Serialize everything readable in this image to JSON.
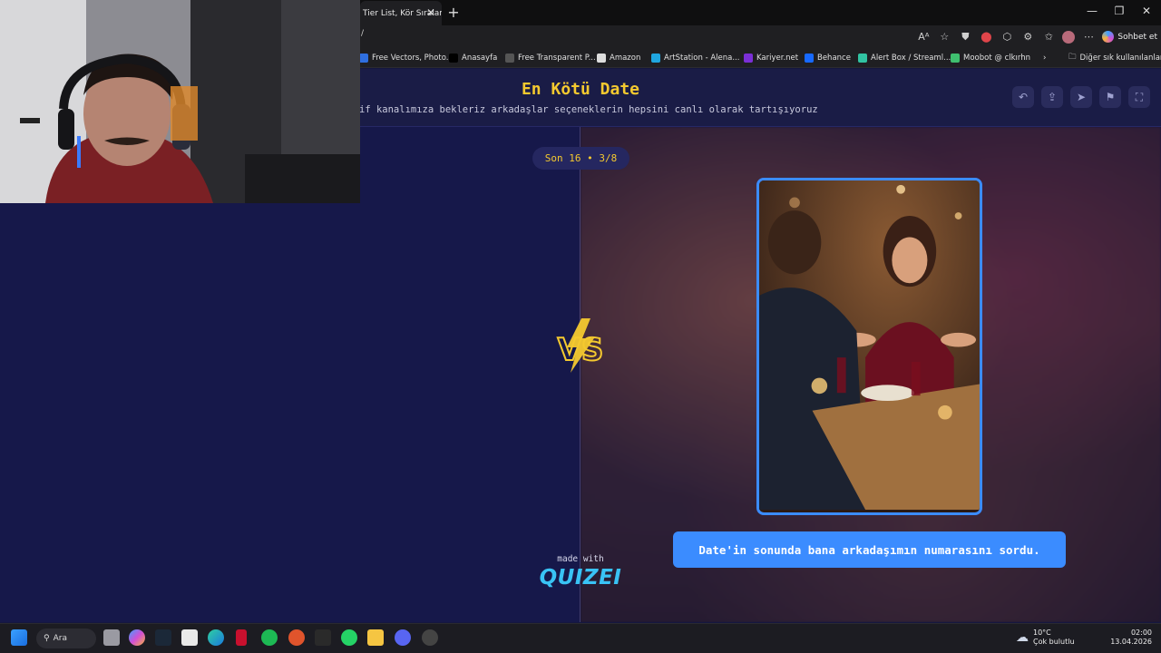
{
  "browser": {
    "tab_title": "Tier List, Kör Sıralam",
    "url_fragment": "/",
    "copilot_label": "Sohbet et",
    "bookmarks": [
      {
        "label": "Free Vectors, Photo...",
        "icon": "freepik-icon",
        "color": "#2f6fdf"
      },
      {
        "label": "Anasayfa",
        "icon": "x-icon",
        "color": "#000000"
      },
      {
        "label": "Free Transparent P...",
        "icon": "pngtree-icon",
        "color": "#555555"
      },
      {
        "label": "Amazon",
        "icon": "amazon-icon",
        "color": "#dddddd"
      },
      {
        "label": "ArtStation - Alena...",
        "icon": "artstation-icon",
        "color": "#1fa6e0"
      },
      {
        "label": "Kariyer.net",
        "icon": "kariyer-icon",
        "color": "#7b2fd6"
      },
      {
        "label": "Behance",
        "icon": "behance-icon",
        "color": "#1769ff"
      },
      {
        "label": "Alert Box / Streaml...",
        "icon": "streamlabs-icon",
        "color": "#31c3a2"
      },
      {
        "label": "Moobot @ clkırhn",
        "icon": "moobot-icon",
        "color": "#3fbf6f"
      }
    ],
    "other_bookmarks_label": "Diğer sık kullanılanlar"
  },
  "game": {
    "title": "En Kötü Date",
    "subtitle": "if kanalımıza bekleriz arkadaşlar seçeneklerin hepsini canlı olarak tartışıyoruz",
    "counter": "Son 16 • 3/8",
    "vs_label": "VS",
    "caption": "Date'in sonunda bana arkadaşımın numarasını sordu.",
    "made_with": "made with",
    "brand": "QUIZEI",
    "header_buttons": [
      "undo-icon",
      "share-icon",
      "send-icon",
      "flag-icon",
      "fullscreen-icon"
    ]
  },
  "taskbar": {
    "search_label": "Ara",
    "weather_temp": "10°C",
    "weather_desc": "Çok bulutlu",
    "time": "02:00",
    "date": "13.04.2026"
  },
  "colors": {
    "accent_yellow": "#f4c92f",
    "accent_blue": "#3b8cff",
    "page_bg": "#15173f",
    "brand_cyan": "#39c3f5"
  }
}
